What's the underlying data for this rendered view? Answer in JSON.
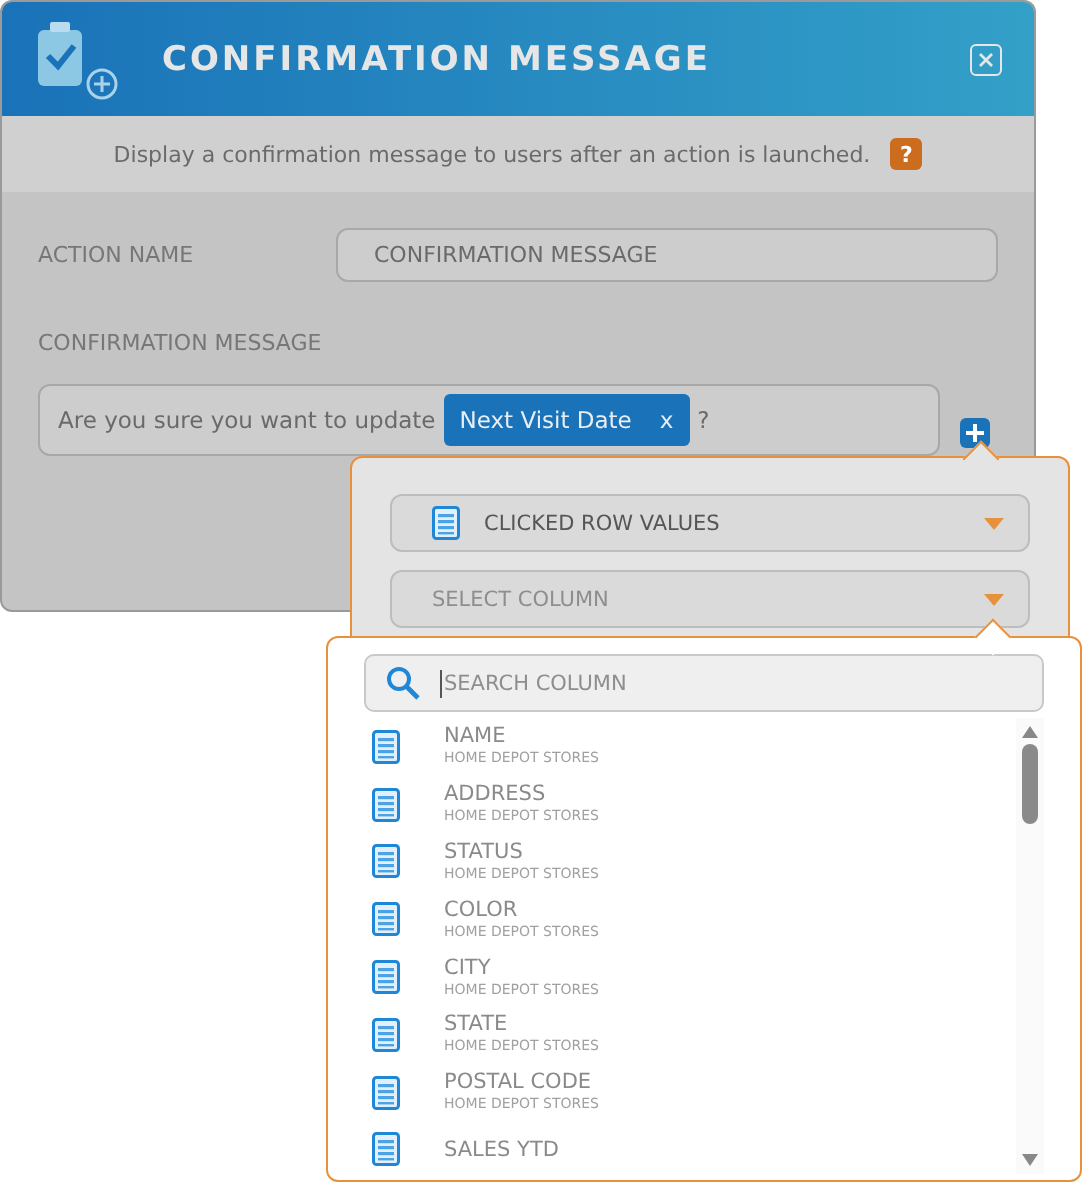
{
  "dialog": {
    "title": "CONFIRMATION MESSAGE",
    "description": "Display a confirmation message to users after an action is launched.",
    "help": "?"
  },
  "action_name": {
    "label": "ACTION NAME",
    "value": "CONFIRMATION MESSAGE"
  },
  "confirmation_message": {
    "label": "CONFIRMATION MESSAGE",
    "text_before": "Are you sure you want to update",
    "tag": {
      "label": "Next Visit Date",
      "remove": "x"
    },
    "text_after": "?"
  },
  "source_dropdown": {
    "value": "CLICKED ROW VALUES"
  },
  "column_dropdown": {
    "placeholder": "SELECT COLUMN"
  },
  "column_search": {
    "placeholder": "SEARCH COLUMN"
  },
  "columns": [
    {
      "name": "NAME",
      "source": "HOME DEPOT STORES"
    },
    {
      "name": "ADDRESS",
      "source": "HOME DEPOT STORES"
    },
    {
      "name": "STATUS",
      "source": "HOME DEPOT STORES"
    },
    {
      "name": "COLOR",
      "source": "HOME DEPOT STORES"
    },
    {
      "name": "CITY",
      "source": "HOME DEPOT STORES"
    },
    {
      "name": "STATE",
      "source": "HOME DEPOT STORES"
    },
    {
      "name": "POSTAL CODE",
      "source": "HOME DEPOT STORES"
    },
    {
      "name": "SALES YTD"
    }
  ]
}
